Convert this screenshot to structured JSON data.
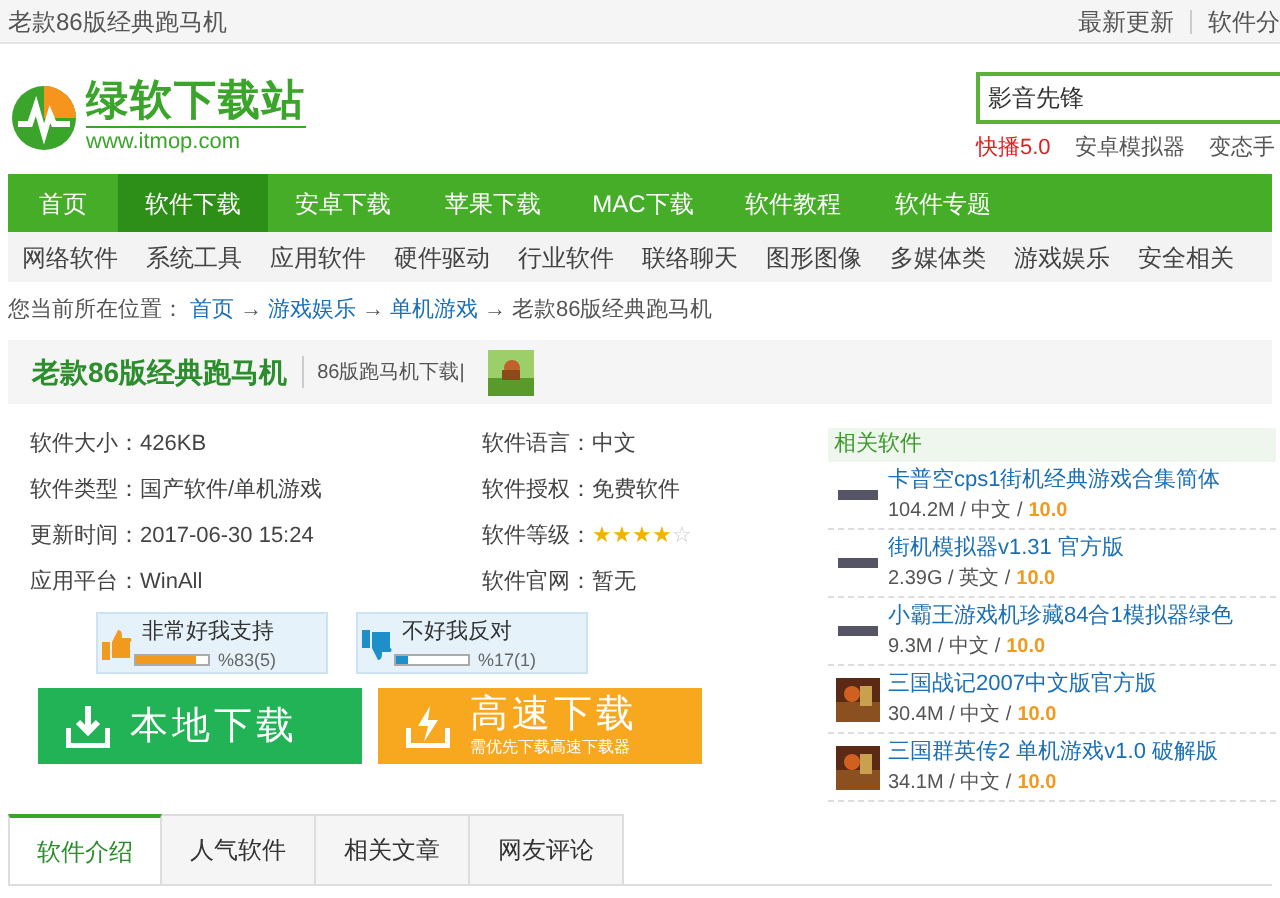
{
  "top_bar": {
    "page_title": "老款86版经典跑马机",
    "links": [
      "最新更新",
      "软件分"
    ]
  },
  "header": {
    "logo": {
      "name": "绿软下载站",
      "url": "www.itmop.com"
    },
    "search": {
      "value": "影音先锋"
    },
    "hot_words": [
      {
        "text": "快播5.0",
        "hot": true
      },
      {
        "text": "安卓模拟器",
        "hot": false
      },
      {
        "text": "变态手",
        "hot": false
      }
    ]
  },
  "nav": [
    {
      "label": "首页",
      "selected": false
    },
    {
      "label": "软件下载",
      "selected": true
    },
    {
      "label": "安卓下载",
      "selected": false
    },
    {
      "label": "苹果下载",
      "selected": false
    },
    {
      "label": "MAC下载",
      "selected": false
    },
    {
      "label": "软件教程",
      "selected": false
    },
    {
      "label": "软件专题",
      "selected": false
    }
  ],
  "subnav": [
    "网络软件",
    "系统工具",
    "应用软件",
    "硬件驱动",
    "行业软件",
    "联络聊天",
    "图形图像",
    "多媒体类",
    "游戏娱乐",
    "安全相关"
  ],
  "breadcrumb": {
    "prefix": "您当前所在位置：",
    "links": [
      "首页",
      "游戏娱乐",
      "单机游戏"
    ],
    "current": "老款86版经典跑马机",
    "separator": "→"
  },
  "title": {
    "name": "老款86版经典跑马机",
    "subtitle": "86版跑马机下载|"
  },
  "info": [
    {
      "label": "软件大小：",
      "value": "426KB"
    },
    {
      "label": "软件语言：",
      "value": "中文"
    },
    {
      "label": "软件类型：",
      "value": "国产软件/单机游戏"
    },
    {
      "label": "软件授权：",
      "value": "免费软件"
    },
    {
      "label": "更新时间：",
      "value": "2017-06-30 15:24"
    },
    {
      "label": "软件等级：",
      "stars": 4
    },
    {
      "label": "应用平台：",
      "value": "WinAll"
    },
    {
      "label": "软件官网：",
      "value": "暂无"
    }
  ],
  "votes": [
    {
      "kind": "up",
      "label": "非常好我支持",
      "level": 0.83,
      "count": "%83(5)"
    },
    {
      "kind": "down",
      "label": "不好我反对",
      "level": 0.17,
      "count": "%17(1)"
    }
  ],
  "downloads": [
    {
      "kind": "local",
      "label": "本地下载"
    },
    {
      "kind": "fast",
      "label": "高速下载",
      "note": "需优先下载高速下载器"
    }
  ],
  "related": {
    "title": "相关软件",
    "items": [
      {
        "kind": "logo",
        "name": "卡普空cps1街机经典游戏合集简体",
        "meta": "104.2M / 中文 /",
        "score": "10.0"
      },
      {
        "kind": "logo",
        "name": "街机模拟器v1.31 官方版",
        "meta": "2.39G / 英文 /",
        "score": "10.0"
      },
      {
        "kind": "logo",
        "name": "小霸王游戏机珍藏84合1模拟器绿色",
        "meta": "9.3M / 中文 /",
        "score": "10.0"
      },
      {
        "kind": "picture",
        "name": "三国战记2007中文版官方版",
        "meta": "30.4M / 中文 /",
        "score": "10.0"
      },
      {
        "kind": "picture",
        "name": "三国群英传2 单机游戏v1.0 破解版",
        "meta": "34.1M / 中文 /",
        "score": "10.0"
      }
    ]
  },
  "tabs": [
    {
      "label": "软件介绍",
      "selected": true
    },
    {
      "label": "人气软件",
      "selected": false
    },
    {
      "label": "相关文章",
      "selected": false
    },
    {
      "label": "网友评论",
      "selected": false
    }
  ]
}
